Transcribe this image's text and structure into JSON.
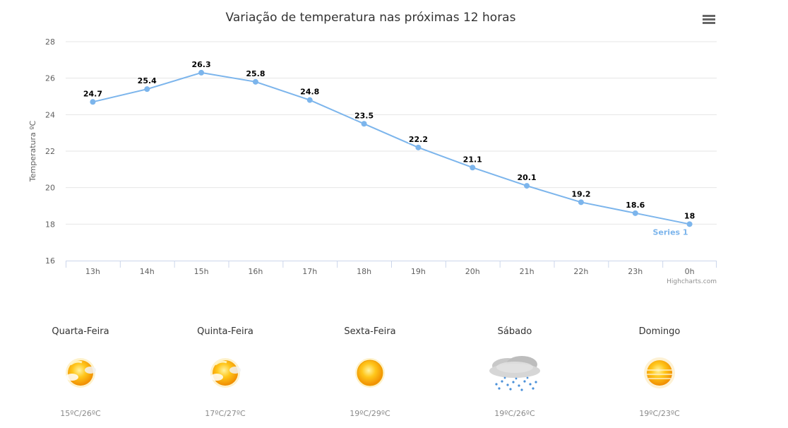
{
  "chart_data": {
    "type": "line",
    "title": "Variação de temperatura nas próximas 12 horas",
    "xlabel": "",
    "ylabel": "Temperatura ºC",
    "categories": [
      "13h",
      "14h",
      "15h",
      "16h",
      "17h",
      "18h",
      "19h",
      "20h",
      "21h",
      "22h",
      "23h",
      "0h"
    ],
    "series": [
      {
        "name": "Series 1",
        "values": [
          24.7,
          25.4,
          26.3,
          25.8,
          24.8,
          23.5,
          22.2,
          21.1,
          20.1,
          19.2,
          18.6,
          18
        ],
        "color": "#7cb5ec"
      }
    ],
    "ylim": [
      16,
      28
    ],
    "yticks": [
      16,
      18,
      20,
      22,
      24,
      26,
      28
    ],
    "grid": true,
    "legend": "none",
    "data_labels": true,
    "credits": "Highcharts.com",
    "menu_icon": "hamburger-menu-icon"
  },
  "forecast": [
    {
      "day": "Quarta-Feira",
      "icon": "sun-partly-cloudy-icon",
      "temps": "15ºC/26ºC"
    },
    {
      "day": "Quinta-Feira",
      "icon": "sun-partly-cloudy-icon",
      "temps": "17ºC/27ºC"
    },
    {
      "day": "Sexta-Feira",
      "icon": "sun-icon",
      "temps": "19ºC/29ºC"
    },
    {
      "day": "Sábado",
      "icon": "rain-cloud-icon",
      "temps": "19ºC/26ºC"
    },
    {
      "day": "Domingo",
      "icon": "sun-hazy-icon",
      "temps": "19ºC/23ºC"
    }
  ]
}
